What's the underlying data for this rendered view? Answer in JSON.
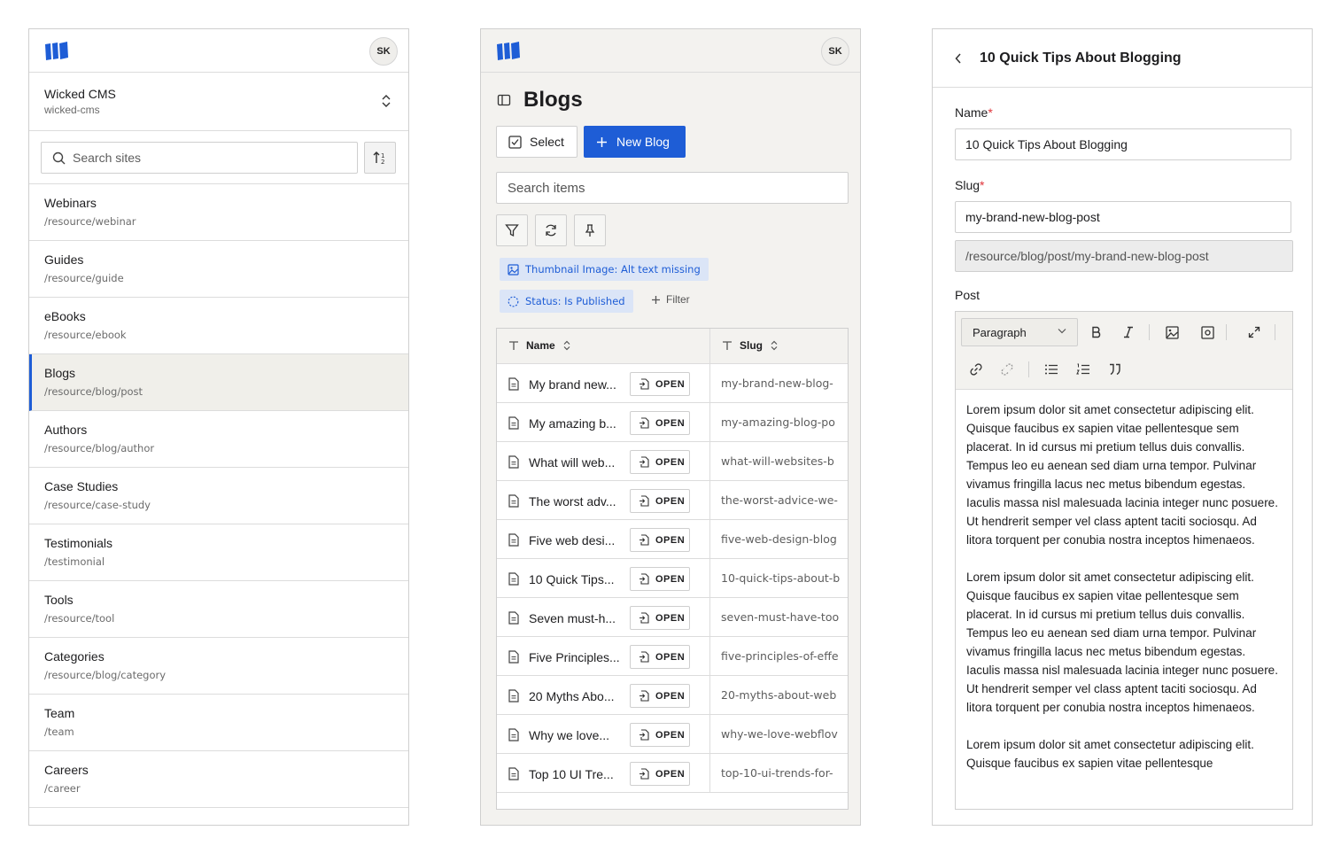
{
  "user": {
    "initials": "SK"
  },
  "colors": {
    "accent": "#1e5dd6",
    "required": "#e0343a",
    "active_bg": "#f0efea"
  },
  "sites_panel": {
    "site_name": "Wicked CMS",
    "site_slug": "wicked-cms",
    "search_placeholder": "Search sites",
    "collections": [
      {
        "name": "Webinars",
        "path": "/resource/webinar"
      },
      {
        "name": "Guides",
        "path": "/resource/guide"
      },
      {
        "name": "eBooks",
        "path": "/resource/ebook"
      },
      {
        "name": "Blogs",
        "path": "/resource/blog/post",
        "active": true
      },
      {
        "name": "Authors",
        "path": "/resource/blog/author"
      },
      {
        "name": "Case Studies",
        "path": "/resource/case-study"
      },
      {
        "name": "Testimonials",
        "path": "/testimonial"
      },
      {
        "name": "Tools",
        "path": "/resource/tool"
      },
      {
        "name": "Categories",
        "path": "/resource/blog/category"
      },
      {
        "name": "Team",
        "path": "/team"
      },
      {
        "name": "Careers",
        "path": "/career"
      }
    ]
  },
  "blogs_panel": {
    "title": "Blogs",
    "select_label": "Select",
    "new_label": "New Blog",
    "search_placeholder": "Search items",
    "chips": [
      "Thumbnail Image: Alt text missing",
      "Status: Is Published"
    ],
    "add_filter_label": "Filter",
    "columns": [
      "Name",
      "Slug"
    ],
    "open_label": "OPEN",
    "rows": [
      {
        "name": "My brand new...",
        "slug": "my-brand-new-blog-"
      },
      {
        "name": "My amazing b...",
        "slug": "my-amazing-blog-po"
      },
      {
        "name": "What will web...",
        "slug": "what-will-websites-b"
      },
      {
        "name": "The worst adv...",
        "slug": "the-worst-advice-we-"
      },
      {
        "name": "Five web desi...",
        "slug": "five-web-design-blog"
      },
      {
        "name": "10 Quick Tips...",
        "slug": "10-quick-tips-about-b"
      },
      {
        "name": "Seven must-h...",
        "slug": "seven-must-have-too"
      },
      {
        "name": "Five Principles...",
        "slug": "five-principles-of-effe"
      },
      {
        "name": "20 Myths Abo...",
        "slug": "20-myths-about-web"
      },
      {
        "name": "Why we love...",
        "slug": "why-we-love-webflov"
      },
      {
        "name": "Top 10 UI Tre...",
        "slug": "top-10-ui-trends-for-"
      }
    ]
  },
  "editor_panel": {
    "title": "10 Quick Tips About Blogging",
    "name_label": "Name",
    "name_value": "10 Quick Tips About Blogging",
    "slug_label": "Slug",
    "slug_value": "my-brand-new-blog-post",
    "path_value": "/resource/blog/post/my-brand-new-blog-post",
    "post_label": "Post",
    "block_format": "Paragraph",
    "paragraphs": [
      "Lorem ipsum dolor sit amet consectetur adipiscing elit. Quisque faucibus ex sapien vitae pellentesque sem placerat. In id cursus mi pretium tellus duis convallis. Tempus leo eu aenean sed diam urna tempor. Pulvinar vivamus fringilla lacus nec metus bibendum egestas. Iaculis massa nisl malesuada lacinia integer nunc posuere. Ut hendrerit semper vel class aptent taciti sociosqu. Ad litora torquent per conubia nostra inceptos himenaeos.",
      "Lorem ipsum dolor sit amet consectetur adipiscing elit. Quisque faucibus ex sapien vitae pellentesque sem placerat. In id cursus mi pretium tellus duis convallis. Tempus leo eu aenean sed diam urna tempor. Pulvinar vivamus fringilla lacus nec metus bibendum egestas. Iaculis massa nisl malesuada lacinia integer nunc posuere. Ut hendrerit semper vel class aptent taciti sociosqu. Ad litora torquent per conubia nostra inceptos himenaeos.",
      "Lorem ipsum dolor sit amet consectetur adipiscing elit. Quisque faucibus ex sapien vitae pellentesque"
    ]
  }
}
